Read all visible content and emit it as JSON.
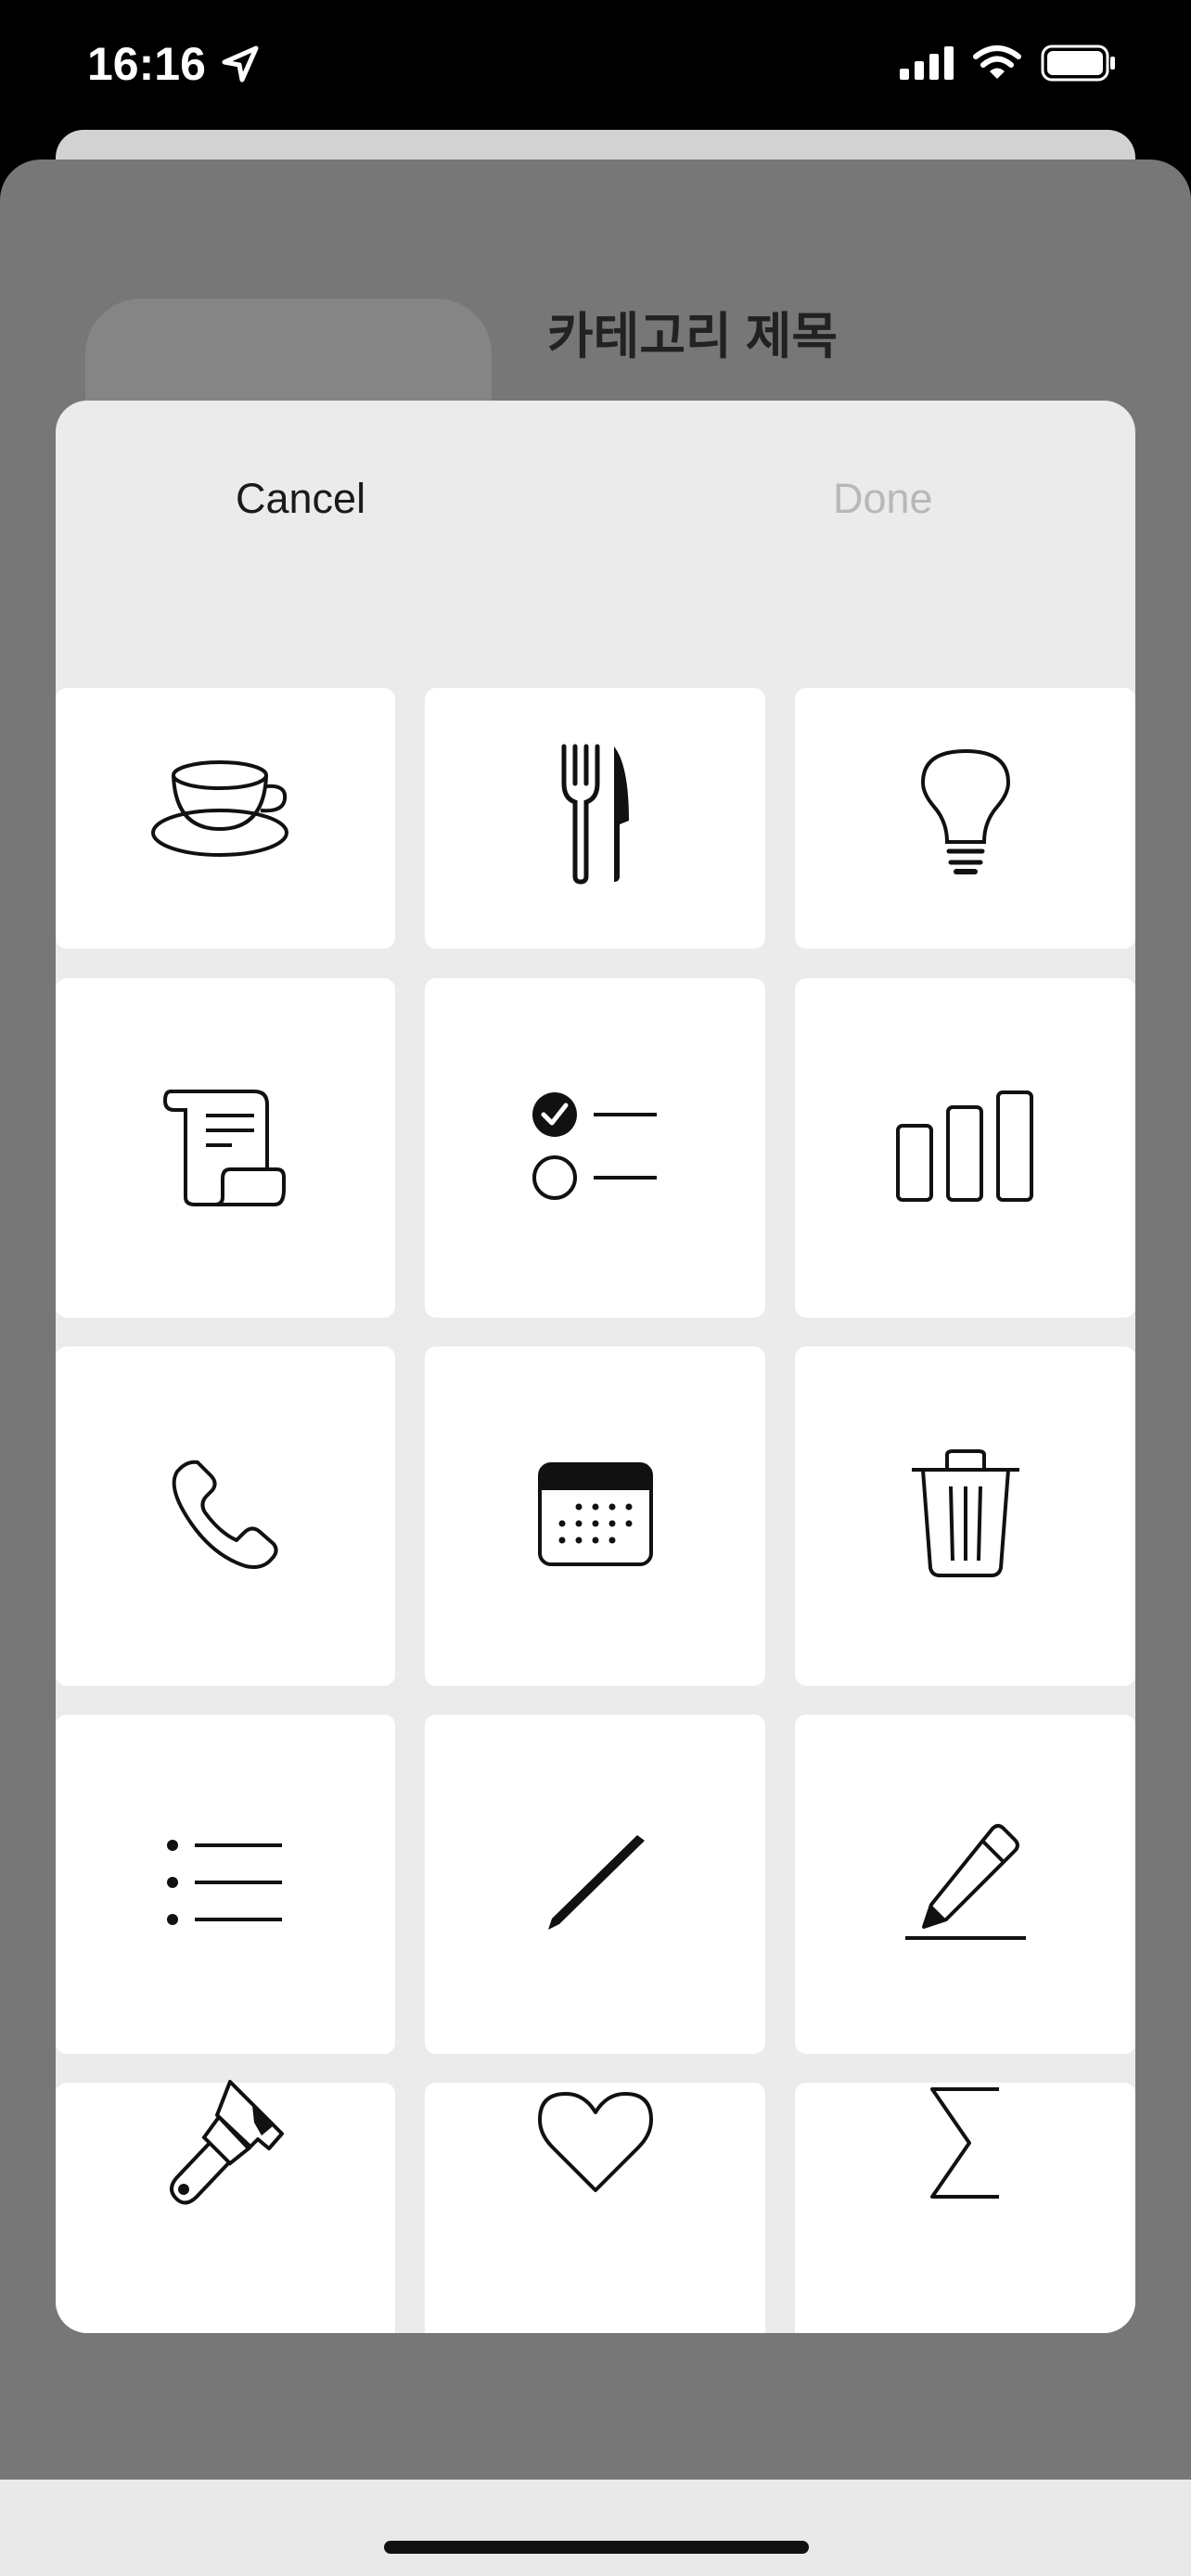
{
  "status_bar": {
    "time": "16:16"
  },
  "background_sheet": {
    "title": "카테고리 제목"
  },
  "picker": {
    "cancel_label": "Cancel",
    "done_label": "Done",
    "icons": [
      "coffee-cup-icon",
      "fork-knife-icon",
      "lightbulb-icon",
      "scroll-icon",
      "checklist-icon",
      "bar-chart-icon",
      "phone-icon",
      "calendar-icon",
      "trash-icon",
      "bullet-list-icon",
      "pencil-icon",
      "pencil-line-icon",
      "paintbrush-icon",
      "heart-icon",
      "sigma-icon"
    ]
  },
  "colors": {
    "sheet_gray": "#777777",
    "picker_bg": "#ebebeb",
    "cell_bg": "#ffffff",
    "done_disabled": "#b8b8b8"
  }
}
